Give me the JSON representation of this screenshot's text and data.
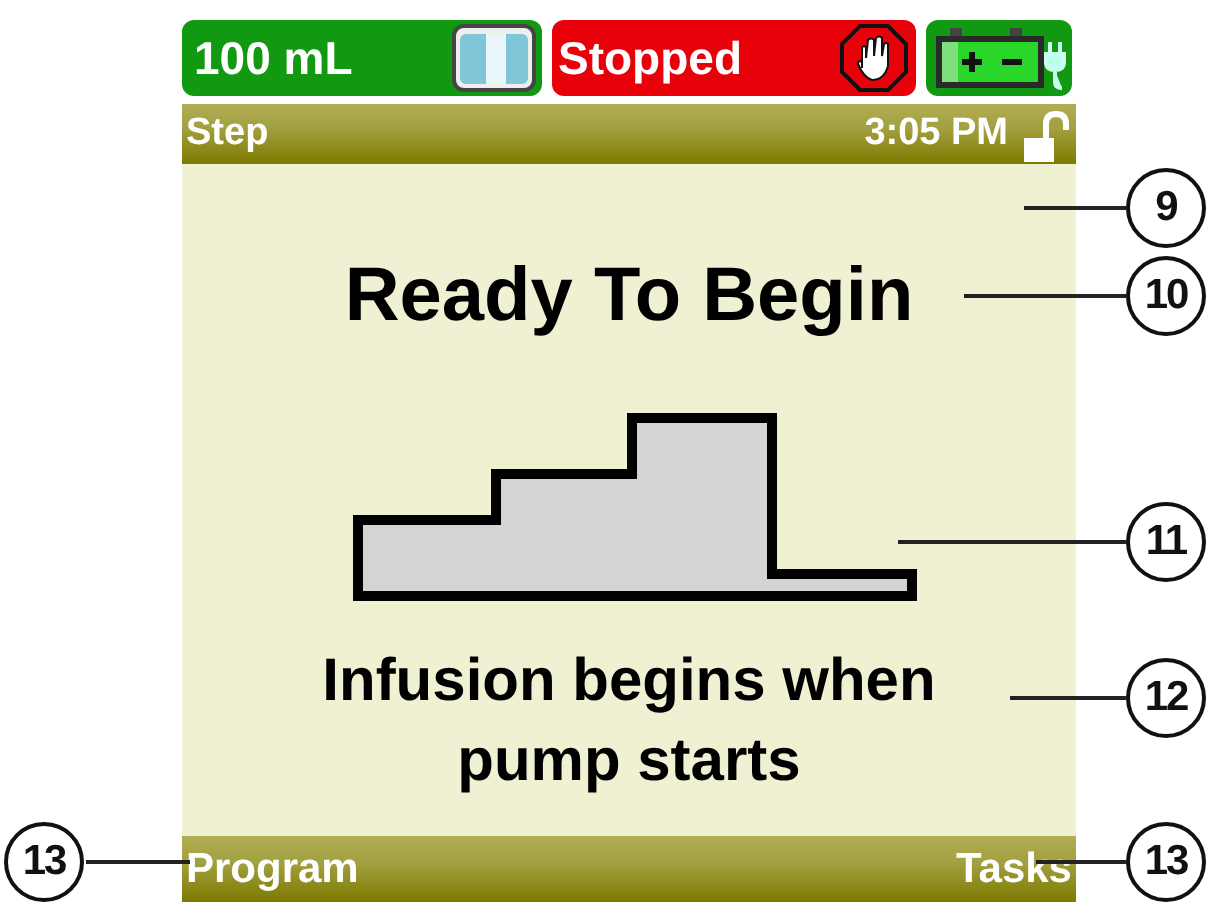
{
  "status_bar": {
    "volume": "100 mL",
    "state": "Stopped"
  },
  "title_bar": {
    "title": "Step",
    "time": "3:05 PM"
  },
  "main": {
    "heading": "Ready To Begin",
    "message": "Infusion begins when pump starts"
  },
  "softkeys": [
    {
      "label": "Program"
    },
    {
      "label": "Tasks"
    }
  ],
  "callouts": [
    {
      "label": "9"
    },
    {
      "label": "10"
    },
    {
      "label": "11"
    },
    {
      "label": "12"
    },
    {
      "label": "13"
    },
    {
      "label": "13"
    }
  ]
}
